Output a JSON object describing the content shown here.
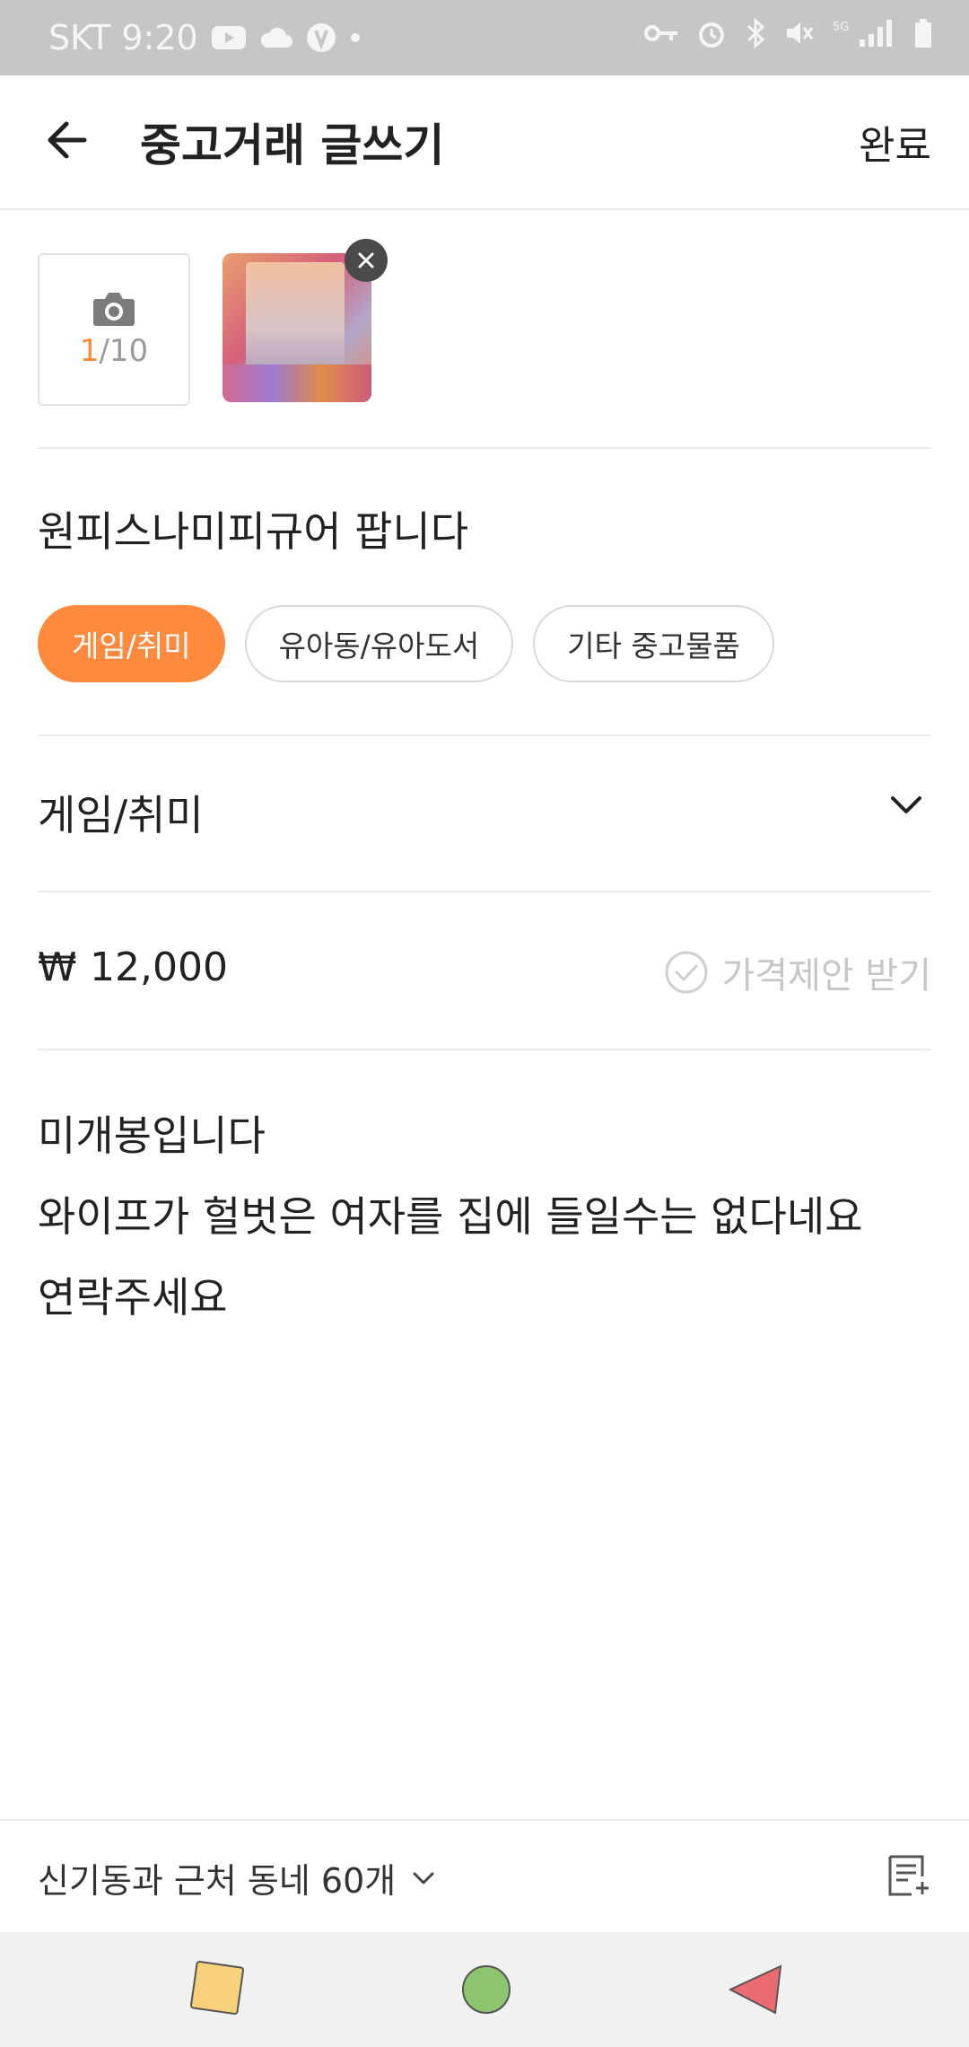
{
  "status_bar": {
    "carrier_time": "SKT 9:20"
  },
  "header": {
    "title": "중고거래 글쓰기",
    "done_label": "완료"
  },
  "photos": {
    "current_count": "1",
    "max_label": "/10"
  },
  "post": {
    "title": "원피스나미피규어 팝니다",
    "suggested_categories": [
      "게임/취미",
      "유아동/유아도서",
      "기타 중고물품"
    ],
    "category": "게임/취미",
    "currency_symbol": "₩",
    "price": "12,000",
    "offer_label": "가격제안 받기",
    "description_lines": [
      "미개봉입니다",
      "와이프가 헐벗은 여자를 집에 들일수는 없다네요",
      "연락주세요"
    ]
  },
  "location": {
    "label": "신기동과 근처 동네 60개"
  },
  "colors": {
    "accent": "#ff8a3d",
    "nav_square": "#f7d27a",
    "nav_circle": "#8cc56d",
    "nav_triangle": "#ec6b73"
  },
  "icons": [
    "youtube-icon",
    "cloud-icon",
    "vpn-key-icon",
    "alarm-icon",
    "bluetooth-icon",
    "mute-icon",
    "signal-icon",
    "battery-icon",
    "back-arrow-icon",
    "camera-icon",
    "close-icon",
    "chevron-down-icon",
    "check-circle-icon",
    "template-icon"
  ]
}
